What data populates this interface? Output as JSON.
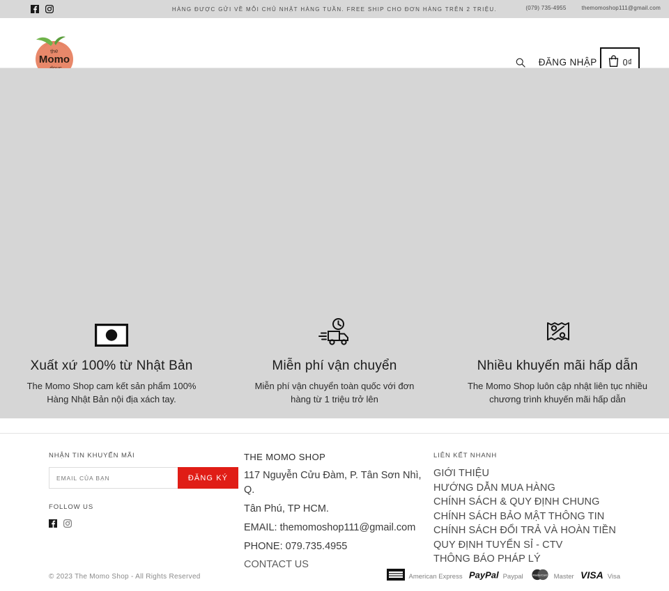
{
  "announcement": {
    "message": "HÀNG ĐƯỢC GỬI VỀ MỖI CHỦ NHẬT HÀNG TUẦN. FREE SHIP CHO ĐƠN HÀNG TRÊN 2 TRIỆU.",
    "phone": "(079) 735-4955",
    "email": "themomoshop111@gmail.com",
    "social": [
      "facebook-icon",
      "instagram-icon"
    ],
    "background": "#d8d8d8"
  },
  "header": {
    "logo_text_top": "the",
    "logo_text_main": "Momo",
    "logo_text_bottom": "shop",
    "search_icon": "search-icon",
    "login_label": "ĐĂNG NHẬP",
    "cart_icon": "shopping-bag-icon",
    "cart_total": "0₫"
  },
  "main": {
    "background": "#d6d6d6",
    "features": [
      {
        "icon": "japan-flag-icon",
        "title": "Xuất xứ 100% từ Nhật Bản",
        "desc": "The Momo Shop cam kết sản phẩm 100% Hàng Nhật Bản nội địa xách tay."
      },
      {
        "icon": "delivery-truck-icon",
        "title": "Miễn phí vận chuyển",
        "desc": "Miễn phí vận chuyển toàn quốc với đơn hàng từ 1 triệu trở lên"
      },
      {
        "icon": "discount-tag-icon",
        "title": "Nhiều khuyến mãi hấp dẫn",
        "desc": "The Momo Shop luôn cập nhật liên tục nhiều chương trình khuyến mãi hấp dẫn"
      }
    ]
  },
  "footer": {
    "newsletter": {
      "heading": "NHẬN TIN KHUYẾN MÃI",
      "placeholder": "EMAIL CỦA BẠN",
      "button": "ĐĂNG KÝ",
      "button_color": "#e01d16"
    },
    "follow": {
      "heading": "FOLLOW US",
      "icons": [
        "facebook-icon",
        "instagram-icon"
      ]
    },
    "info": {
      "shop_name": "THE MOMO SHOP",
      "address_line1": "117 Nguyễn Cửu Đàm, P. Tân Sơn Nhì, Q.",
      "address_line2": "Tân Phú, TP HCM.",
      "email": "EMAIL: themomoshop111@gmail.com",
      "phone": "PHONE: 079.735.4955",
      "contact_us": "CONTACT US"
    },
    "quick_links": {
      "heading": "LIÊN KẾT NHANH",
      "items": [
        "GIỚI THIỆU",
        "HƯỚNG DẪN MUA HÀNG",
        "CHÍNH SÁCH & QUY ĐỊNH CHUNG",
        "CHÍNH SÁCH BẢO MẬT THÔNG TIN",
        "CHÍNH SÁCH ĐỔI TRẢ VÀ HOÀN TIỀN",
        "QUY ĐỊNH TUYỂN SỈ - CTV",
        "THÔNG BÁO PHÁP LÝ"
      ]
    },
    "bottom": {
      "copyright": "© 2023 The Momo Shop - All Rights Reserved",
      "payments": [
        {
          "icon": "amex-icon",
          "label": "American Express"
        },
        {
          "icon": "paypal-icon",
          "label": "Paypal"
        },
        {
          "icon": "mastercard-icon",
          "label": "Master"
        },
        {
          "icon": "visa-icon",
          "label": "Visa"
        }
      ]
    }
  }
}
